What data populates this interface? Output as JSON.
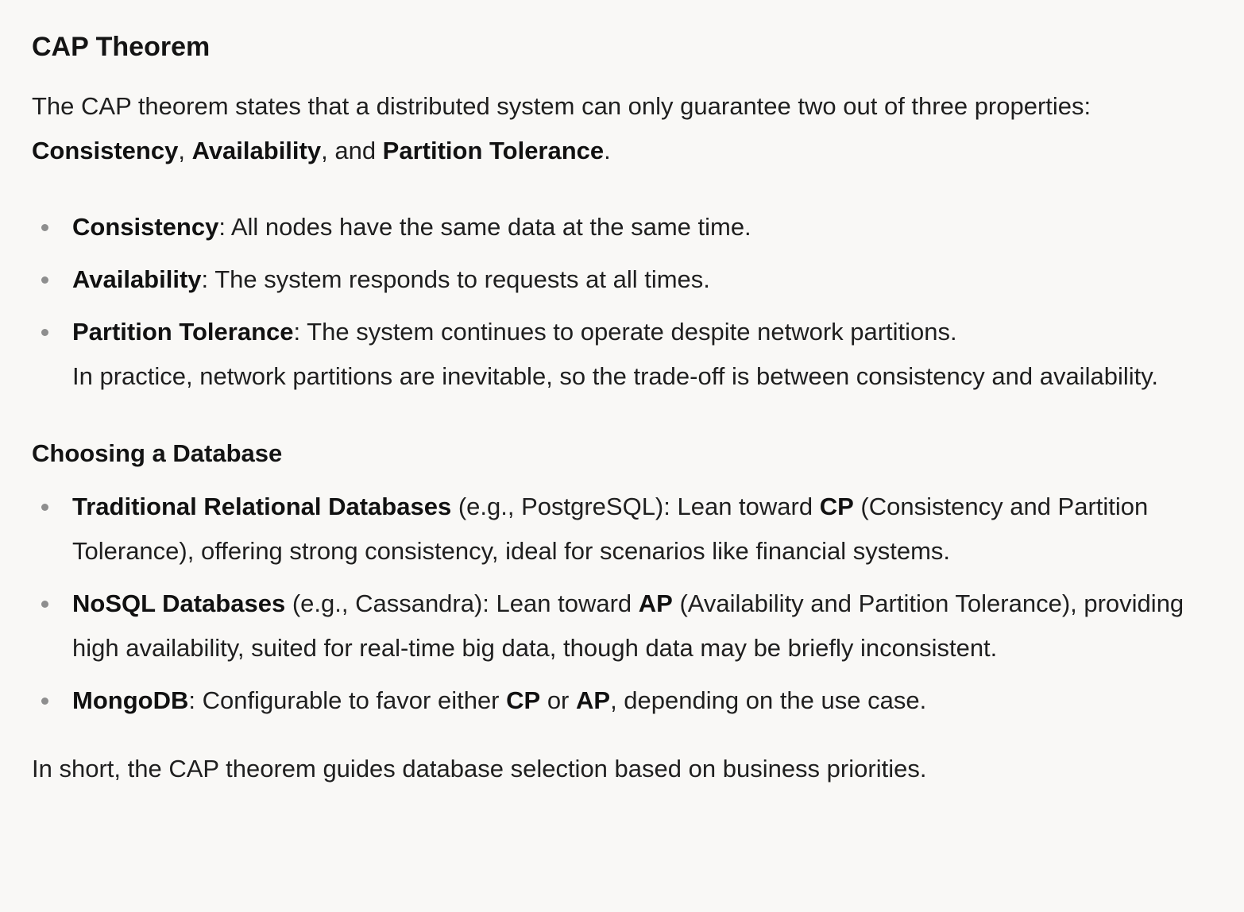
{
  "cap": {
    "title": "CAP Theorem",
    "intro_start": "The CAP theorem states that a distributed system can only guarantee two out of three properties: ",
    "intro_b1": "Consistency",
    "intro_sep1": ", ",
    "intro_b2": "Availability",
    "intro_sep2": ", and ",
    "intro_b3": "Partition Tolerance",
    "intro_end": ".",
    "items": [
      {
        "term": "Consistency",
        "desc": ": All nodes have the same data at the same time."
      },
      {
        "term": "Availability",
        "desc": ": The system responds to requests at all times."
      },
      {
        "term": "Partition Tolerance",
        "desc": ": The system continues to operate despite network partitions.",
        "note": "In practice, network partitions are inevitable, so the trade-off is between consistency and availability."
      }
    ]
  },
  "db": {
    "title": "Choosing a Database",
    "items": [
      {
        "term": "Traditional Relational Databases",
        "t1": " (e.g., PostgreSQL): Lean toward ",
        "b": "CP",
        "t2": " (Consistency and Partition Tolerance), offering strong consistency, ideal for scenarios like financial systems."
      },
      {
        "term": "NoSQL Databases",
        "t1": " (e.g., Cassandra): Lean toward ",
        "b": "AP",
        "t2": " (Availability and Partition Tolerance), providing high availability, suited for real-time big data, though data may be briefly inconsistent."
      },
      {
        "term": "MongoDB",
        "t1": ": Configurable to favor either ",
        "b": "CP",
        "t2": " or ",
        "b2": "AP",
        "t3": ", depending on the use case."
      }
    ]
  },
  "summary": "In short, the CAP theorem guides database selection based on business priorities."
}
